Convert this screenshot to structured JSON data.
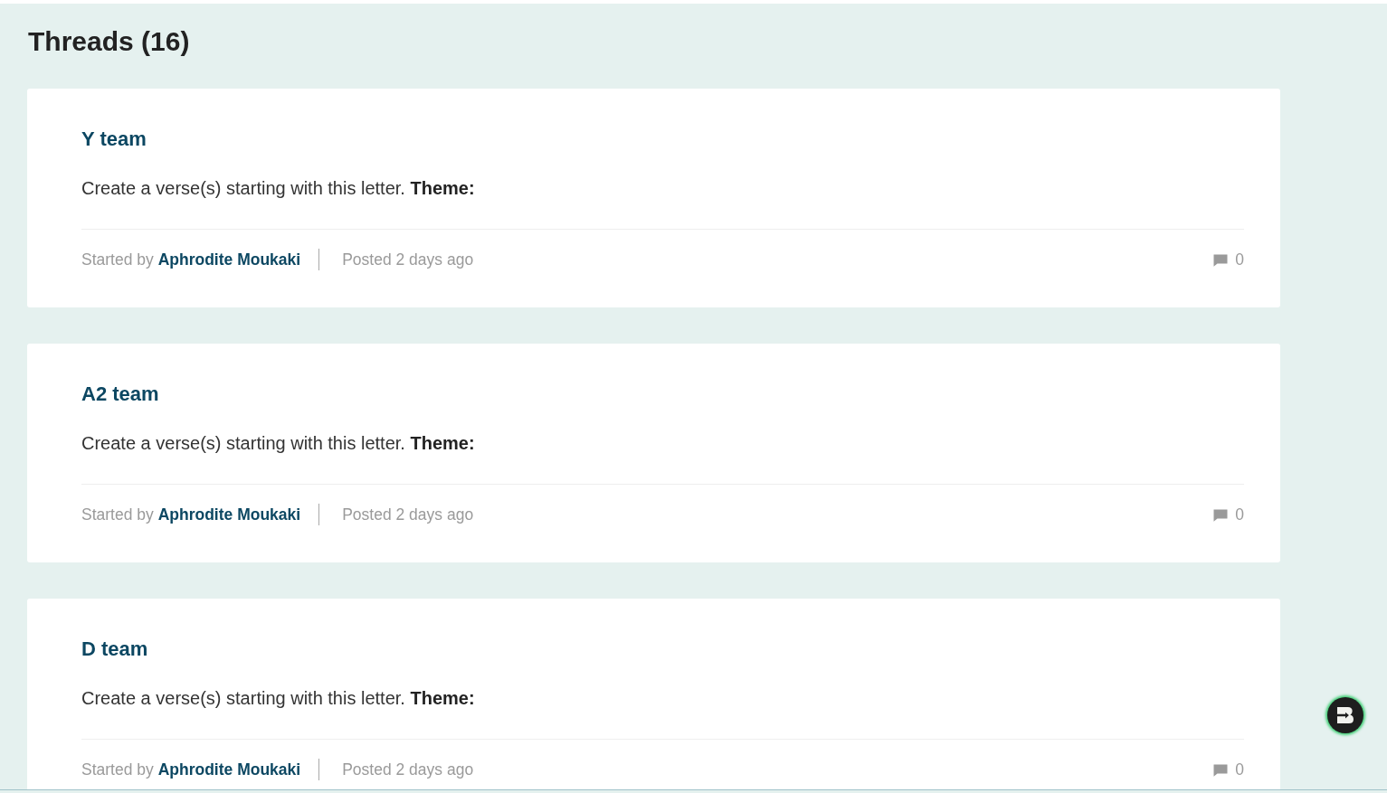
{
  "page": {
    "title": "Threads (16)"
  },
  "threads": [
    {
      "title": "Y team",
      "description": "Create a verse(s) starting with this letter. **Theme:**",
      "started_by": "Started by",
      "author": "Aphrodite Moukaki",
      "posted": "Posted 2 days ago",
      "comment_count": "0"
    },
    {
      "title": "A2 team",
      "description": "Create a verse(s) starting with this letter. **Theme:**",
      "started_by": "Started by",
      "author": "Aphrodite Moukaki",
      "posted": "Posted 2 days ago",
      "comment_count": "0"
    },
    {
      "title": "D team",
      "description": "Create a verse(s) starting with this letter. **Theme:**",
      "started_by": "Started by",
      "author": "Aphrodite Moukaki",
      "posted": "Posted 2 days ago",
      "comment_count": "0"
    }
  ]
}
